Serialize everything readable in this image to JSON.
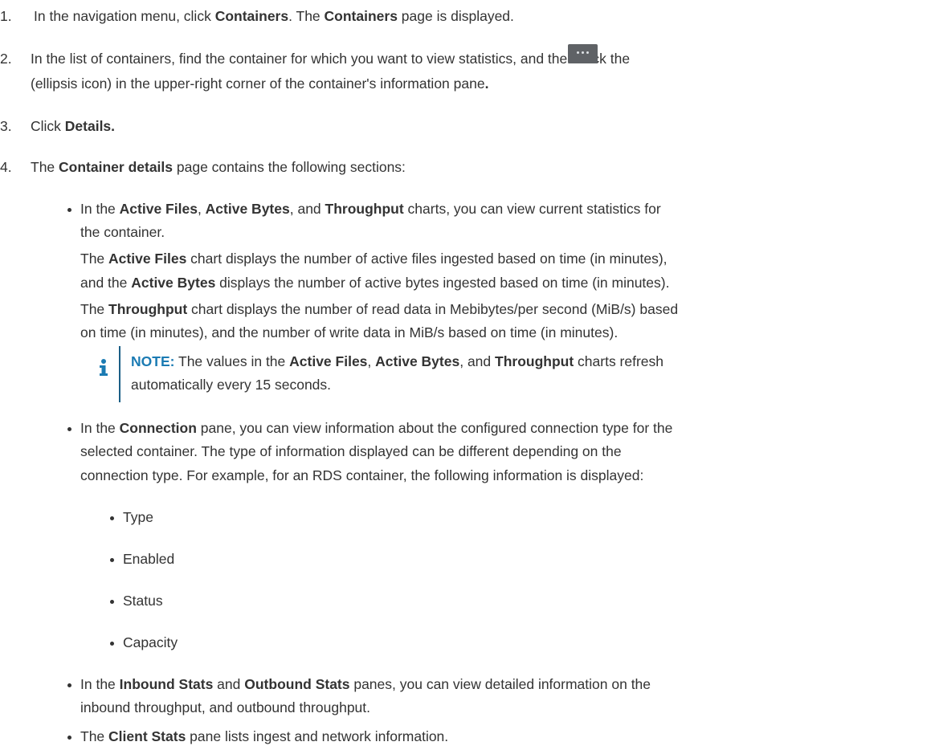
{
  "steps": {
    "s1": {
      "num": "1.",
      "pre": "In the navigation menu, click ",
      "b1": "Containers",
      "mid": ". The ",
      "b2": "Containers",
      "post": " page is displayed."
    },
    "s2": {
      "num": "2.",
      "line1": "In the list of containers, find the container for which you want to view statistics, and then click the",
      "line2_pre": "(ellipsis icon) in the upper-right corner of the container's information pane",
      "line2_bold": "."
    },
    "s3": {
      "num": "3.",
      "pre": "Click ",
      "bold": "Details."
    },
    "s4": {
      "num": "4.",
      "pre": "The ",
      "bold": "Container details",
      "post": " page contains the following sections:"
    }
  },
  "bullet_charts": {
    "l1_pre": "In the ",
    "l1_b1": "Active Files",
    "l1_c1": ", ",
    "l1_b2": "Active Bytes",
    "l1_c2": ", and ",
    "l1_b3": "Throughput",
    "l1_post": " charts, you can view current statistics for",
    "l2": "the container.",
    "l3_pre": "The ",
    "l3_b": "Active Files",
    "l3_post": " chart displays the number of active files ingested based on time (in minutes),",
    "l4_pre": "and the ",
    "l4_b": "Active Bytes",
    "l4_post": " displays the number of active bytes ingested based on time (in minutes).",
    "l5_pre": "The ",
    "l5_b": "Throughput",
    "l5_post": " chart displays the number of read data in Mebibytes/per second (MiB/s) based",
    "l6": "on time (in minutes), and the number of write data in MiB/s based on time (in minutes)."
  },
  "note": {
    "label": "NOTE:",
    "l1_pre": " The values in the ",
    "l1_b1": "Active Files",
    "l1_c1": ", ",
    "l1_b2": "Active Bytes",
    "l1_c2": ", and ",
    "l1_b3": "Throughput",
    "l1_post": " charts refresh",
    "l2": "automatically every 15 seconds."
  },
  "bullet_connection": {
    "l1_pre": "In the ",
    "l1_b": "Connection",
    "l1_post": " pane, you can view information about the configured connection type for the",
    "l2": "selected container. The type of information displayed can be different depending on the",
    "l3": "connection type. For example, for an RDS container, the following information is displayed:",
    "items": [
      "Type",
      "Enabled",
      "Status",
      "Capacity"
    ]
  },
  "bullet_stats": {
    "l1_pre": "In the ",
    "l1_b1": "Inbound Stats",
    "l1_mid": " and ",
    "l1_b2": "Outbound Stats",
    "l1_post": " panes, you can view detailed information on the",
    "l2": "inbound throughput, and outbound throughput."
  },
  "bullet_client": {
    "pre": "The ",
    "bold": "Client Stats",
    "post": " pane lists ingest and network information."
  },
  "colors": {
    "text": "#333333",
    "note_label": "#1b7bb3",
    "note_bar": "#1b5f86",
    "icon_bg": "#5f6266"
  }
}
